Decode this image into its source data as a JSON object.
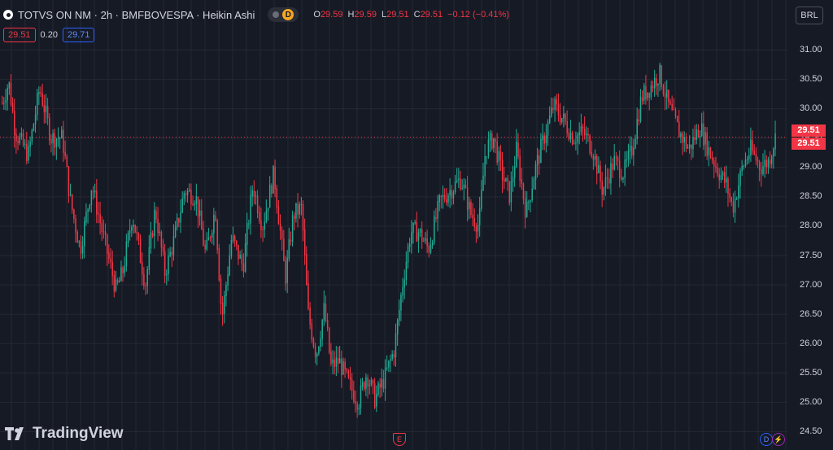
{
  "header": {
    "title": "TOTVS ON NM · 2h · BMFBOVESPA · Heikin Ashi",
    "market_badge": "D",
    "ohlc": {
      "o_key": "O",
      "o_val": "29.59",
      "h_key": "H",
      "h_val": "29.59",
      "l_key": "L",
      "l_val": "29.51",
      "c_key": "C",
      "c_val": "29.51",
      "change": "−0.12 (−0.41%)"
    }
  },
  "trade": {
    "sell": "29.51",
    "spread": "0.20",
    "buy": "29.71"
  },
  "currency": "BRL",
  "price_labels": [
    "29.51",
    "29.51"
  ],
  "y_ticks": [
    "31.00",
    "30.50",
    "30.00",
    "29.50",
    "29.00",
    "28.50",
    "28.00",
    "27.50",
    "27.00",
    "26.50",
    "26.00",
    "25.50",
    "25.00",
    "24.50"
  ],
  "brand": "TradingView",
  "events": {
    "earnings": "E",
    "dividend": "D",
    "split": "⚡"
  },
  "colors": {
    "up": "#22ab94",
    "down": "#f23645",
    "grid": "#242833",
    "background": "#161a25"
  },
  "chart_data": {
    "type": "candlestick",
    "style": "Heikin Ashi",
    "symbol": "TOTVS ON NM",
    "timeframe": "2h",
    "exchange": "BMFBOVESPA",
    "ylim": [
      24.5,
      31.0
    ],
    "last_price": 29.51,
    "path": [
      [
        0,
        30.0
      ],
      [
        10,
        30.45
      ],
      [
        18,
        29.6
      ],
      [
        34,
        29.2
      ],
      [
        48,
        30.35
      ],
      [
        62,
        29.5
      ],
      [
        76,
        29.5
      ],
      [
        86,
        28.4
      ],
      [
        98,
        27.6
      ],
      [
        112,
        28.7
      ],
      [
        125,
        27.9
      ],
      [
        142,
        26.9
      ],
      [
        150,
        27.2
      ],
      [
        162,
        28.2
      ],
      [
        178,
        27.0
      ],
      [
        190,
        28.3
      ],
      [
        202,
        27.2
      ],
      [
        214,
        27.8
      ],
      [
        226,
        28.6
      ],
      [
        240,
        28.5
      ],
      [
        252,
        27.5
      ],
      [
        264,
        28.3
      ],
      [
        272,
        26.4
      ],
      [
        284,
        27.8
      ],
      [
        298,
        27.3
      ],
      [
        310,
        28.7
      ],
      [
        322,
        28.0
      ],
      [
        336,
        28.9
      ],
      [
        350,
        27.1
      ],
      [
        360,
        28.2
      ],
      [
        370,
        28.3
      ],
      [
        378,
        26.5
      ],
      [
        388,
        25.8
      ],
      [
        398,
        26.6
      ],
      [
        406,
        25.6
      ],
      [
        416,
        25.7
      ],
      [
        428,
        25.3
      ],
      [
        440,
        25.0
      ],
      [
        450,
        25.5
      ],
      [
        460,
        25.05
      ],
      [
        472,
        25.4
      ],
      [
        484,
        25.9
      ],
      [
        494,
        27.0
      ],
      [
        504,
        27.9
      ],
      [
        514,
        27.9
      ],
      [
        526,
        27.6
      ],
      [
        540,
        28.4
      ],
      [
        552,
        28.6
      ],
      [
        566,
        28.8
      ],
      [
        578,
        28.2
      ],
      [
        588,
        28.0
      ],
      [
        596,
        29.3
      ],
      [
        606,
        29.5
      ],
      [
        616,
        28.9
      ],
      [
        626,
        28.5
      ],
      [
        634,
        29.3
      ],
      [
        646,
        28.2
      ],
      [
        656,
        28.9
      ],
      [
        668,
        29.5
      ],
      [
        680,
        30.05
      ],
      [
        692,
        29.8
      ],
      [
        704,
        29.5
      ],
      [
        716,
        29.6
      ],
      [
        728,
        29.3
      ],
      [
        740,
        28.6
      ],
      [
        754,
        29.1
      ],
      [
        766,
        28.9
      ],
      [
        776,
        29.3
      ],
      [
        788,
        30.2
      ],
      [
        798,
        30.35
      ],
      [
        810,
        30.6
      ],
      [
        822,
        30.0
      ],
      [
        834,
        29.6
      ],
      [
        846,
        29.3
      ],
      [
        860,
        29.7
      ],
      [
        870,
        29.3
      ],
      [
        880,
        29.0
      ],
      [
        892,
        28.7
      ],
      [
        900,
        28.3
      ],
      [
        912,
        29.0
      ],
      [
        922,
        29.3
      ],
      [
        934,
        29.0
      ],
      [
        944,
        29.1
      ],
      [
        952,
        29.5
      ]
    ]
  }
}
